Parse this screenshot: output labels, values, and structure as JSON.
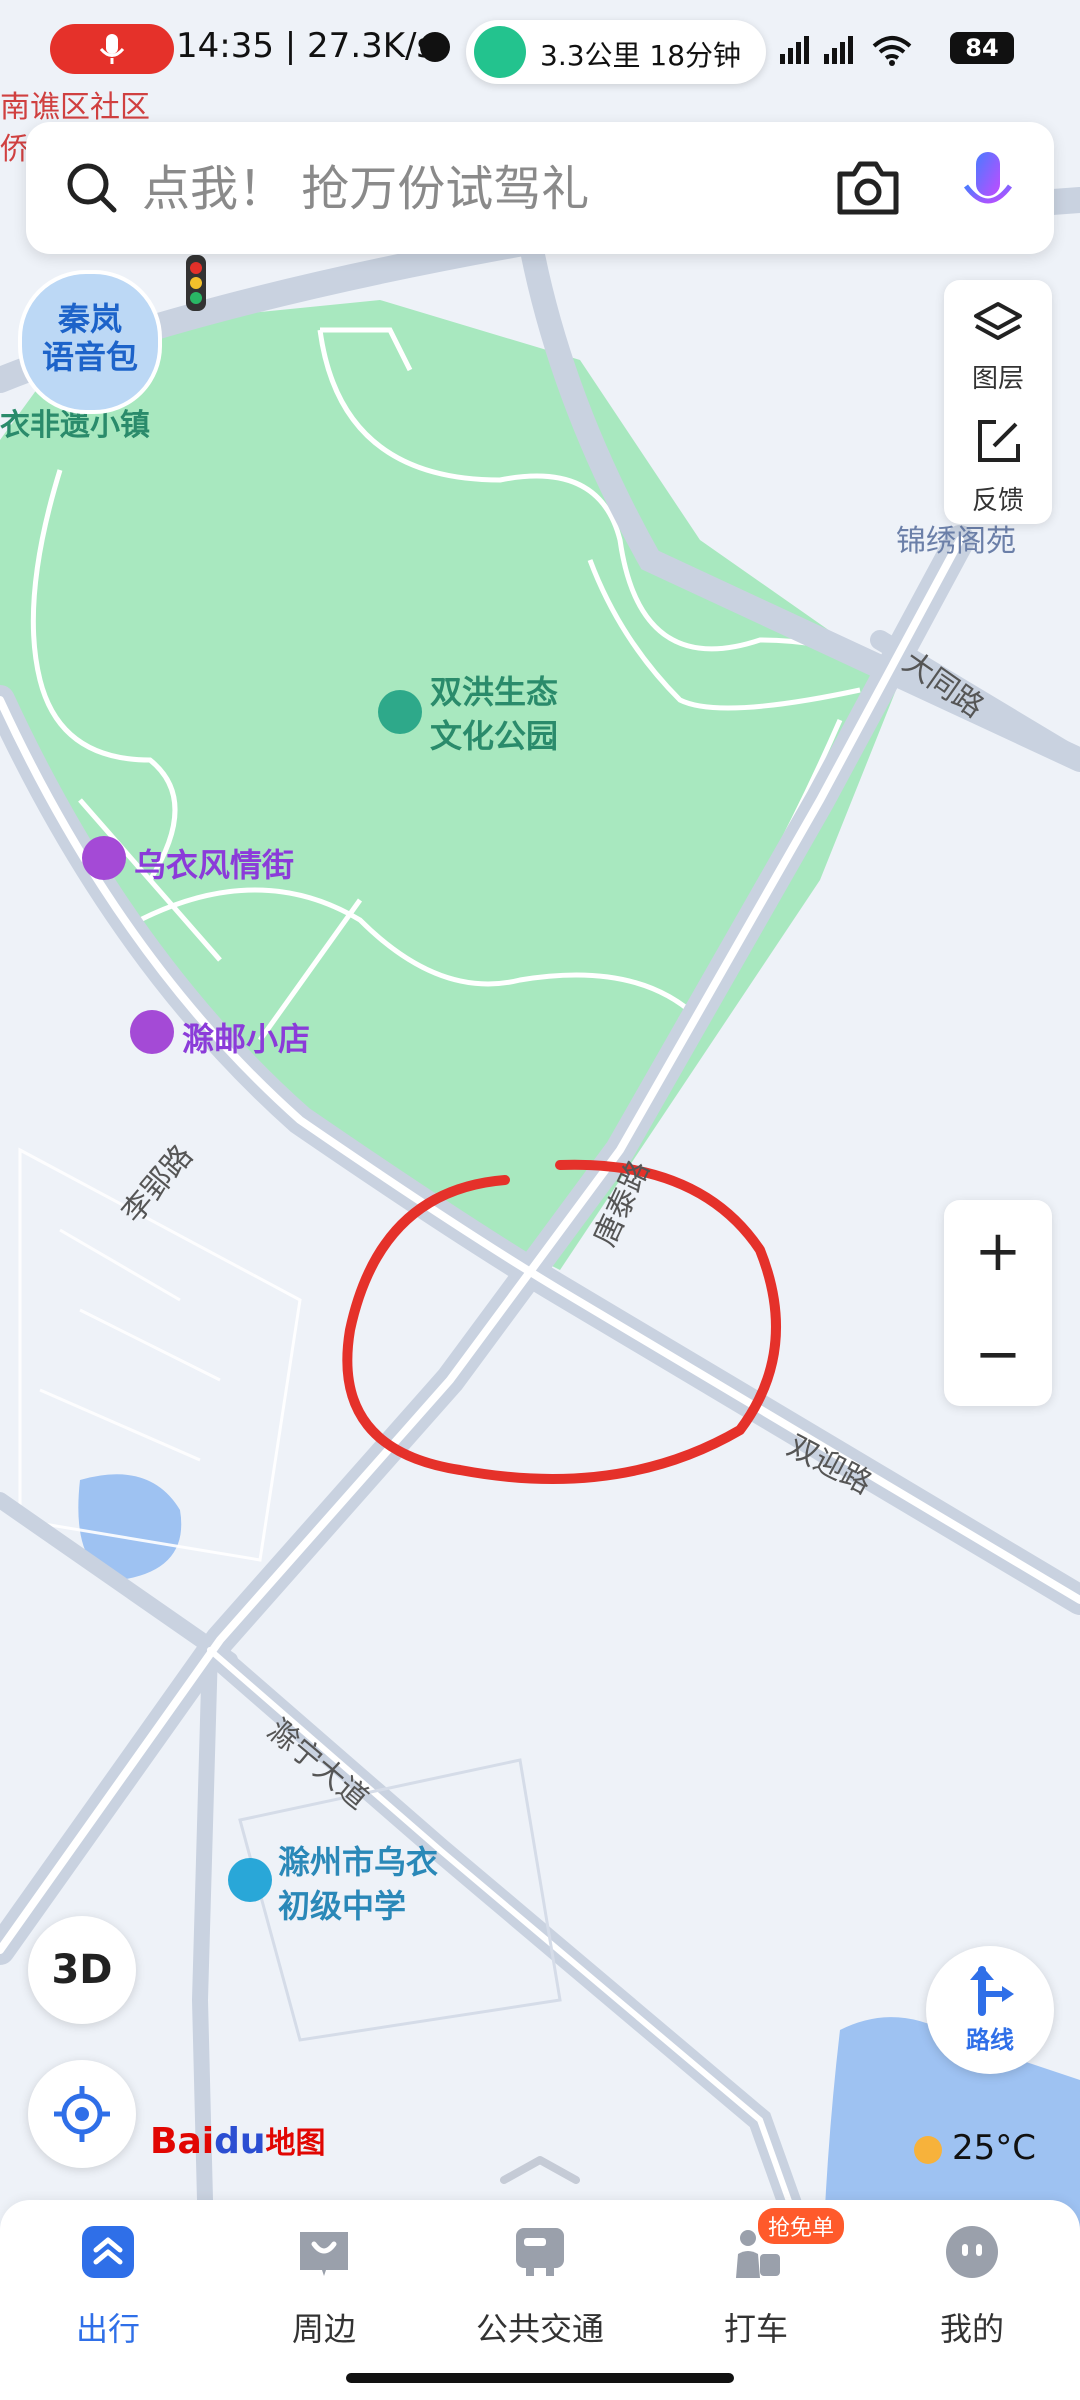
{
  "status": {
    "time_speed": "14:35 | 27.3K/s",
    "nav_distance": "3.3公里 18分钟",
    "battery": "84"
  },
  "search": {
    "placeholder": "点我！ 抢万份试驾礼"
  },
  "side_panel": {
    "layers": "图层",
    "feedback": "反馈"
  },
  "voice_pack": {
    "label": "秦岚\n语音包"
  },
  "map_labels": {
    "top_left_1": "南谯区社区",
    "top_left_2": "侨",
    "town": "衣非遗小镇",
    "park": "双洪生态\n文化公园",
    "street": "乌衣风情街",
    "shop": "滁邮小店",
    "jinxiu": "锦绣阁苑",
    "school": "滁州市乌衣\n初级中学"
  },
  "roads": {
    "datong": "大同路",
    "liying": "李郢路",
    "tangtai": "唐泰路",
    "shuangying": "双迎路",
    "chuning": "滁宁大道"
  },
  "zoom": {
    "plus": "+",
    "minus": "−"
  },
  "buttons": {
    "three_d": "3D",
    "route": "路线"
  },
  "logo": {
    "bai": "Bai",
    "du": "du",
    "map": "地图"
  },
  "weather": {
    "temp": "25°C"
  },
  "tabs": [
    {
      "label": "出行"
    },
    {
      "label": "周边"
    },
    {
      "label": "公共交通"
    },
    {
      "label": "打车",
      "badge": "抢免单"
    },
    {
      "label": "我的"
    }
  ],
  "colors": {
    "accent": "#2f6fe8",
    "park": "#a8e8bf",
    "annotation": "#e5312a"
  }
}
